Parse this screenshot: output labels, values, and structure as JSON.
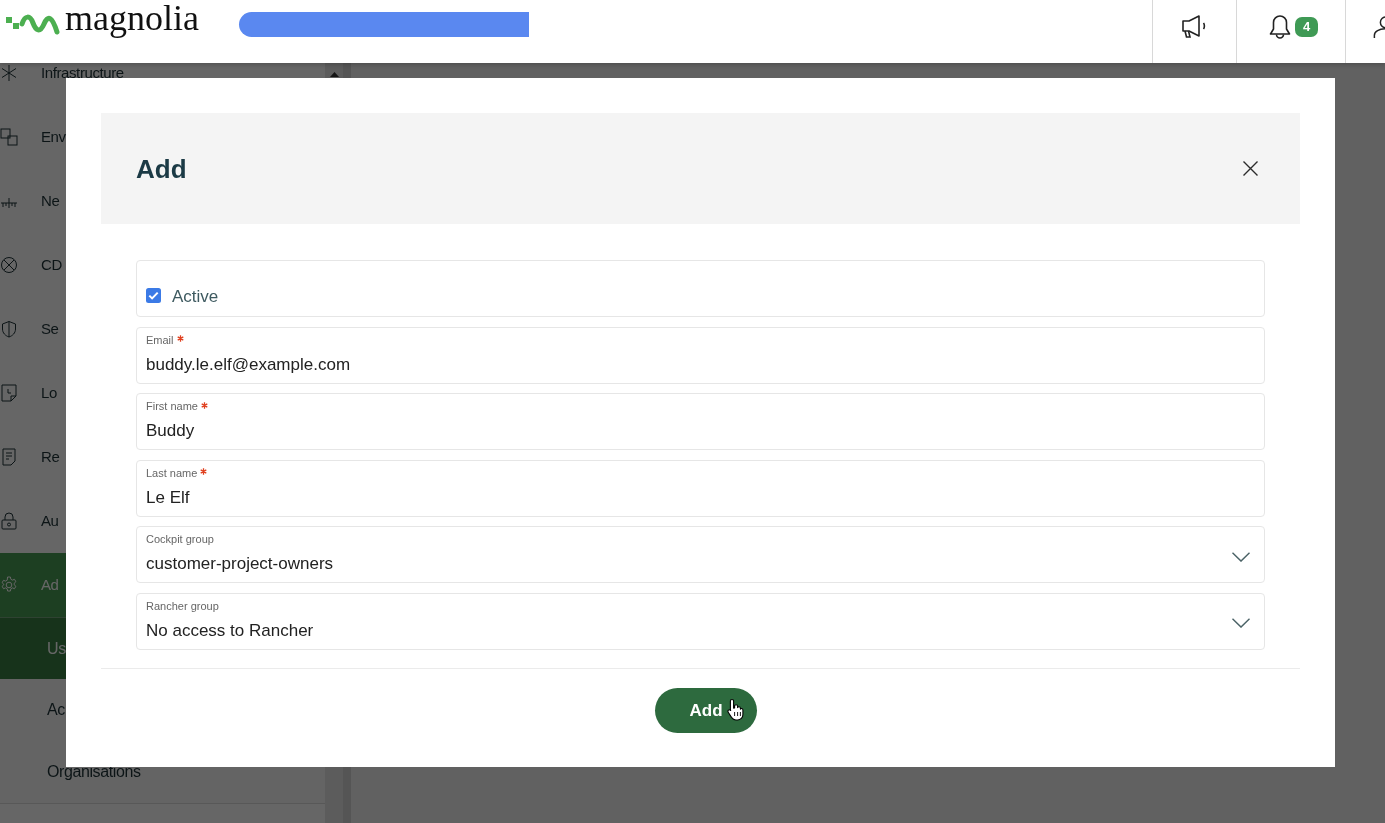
{
  "header": {
    "logo": "magnolia",
    "notification_count": "4"
  },
  "sidebar": {
    "items": [
      {
        "label": "Infrastructure",
        "selected": false
      },
      {
        "label": "Env",
        "selected": false
      },
      {
        "label": "Ne",
        "selected": false
      },
      {
        "label": "CD",
        "selected": false
      },
      {
        "label": "Se",
        "selected": false
      },
      {
        "label": "Lo",
        "selected": false
      },
      {
        "label": "Re",
        "selected": false
      },
      {
        "label": "Au",
        "selected": false
      },
      {
        "label": "Ad",
        "selected": true,
        "children": [
          {
            "label": "Us",
            "selected": true
          },
          {
            "label": "Ac",
            "selected": false
          },
          {
            "label": "Organisations",
            "selected": false
          }
        ]
      }
    ]
  },
  "dialog": {
    "title": "Add",
    "fields": [
      {
        "kind": "checkbox",
        "label": "Active",
        "checked": true
      },
      {
        "kind": "text",
        "label": "Email",
        "required": true,
        "value": "buddy.le.elf@example.com"
      },
      {
        "kind": "text",
        "label": "First name",
        "required": true,
        "value": "Buddy"
      },
      {
        "kind": "text",
        "label": "Last name",
        "required": true,
        "value": "Le Elf"
      },
      {
        "kind": "select",
        "label": "Cockpit group",
        "required": false,
        "value": "customer-project-owners"
      },
      {
        "kind": "select",
        "label": "Rancher group",
        "required": false,
        "value": "No access to Rancher"
      }
    ],
    "submit_button": "Add"
  }
}
